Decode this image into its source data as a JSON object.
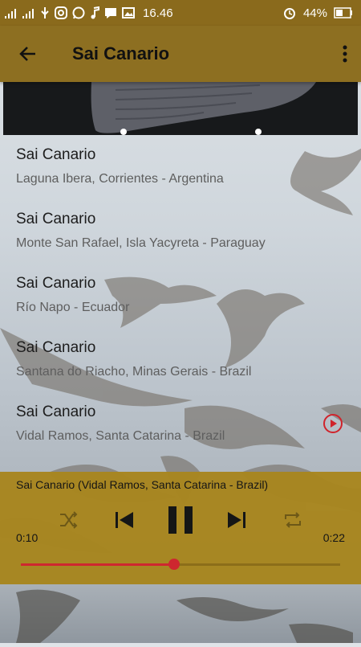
{
  "status_bar": {
    "time": "16.46",
    "battery": "44%",
    "left_icons": [
      "signal-icon",
      "signal-icon",
      "usb-icon",
      "instagram-icon",
      "whatsapp-icon",
      "music-note-icon",
      "message-icon",
      "image-icon"
    ],
    "right_icons": [
      "alarm-icon",
      "battery-icon"
    ]
  },
  "app_bar": {
    "title": "Sai Canario",
    "back_icon": "arrow-back-icon",
    "menu_icon": "more-vert-icon"
  },
  "tracks": [
    {
      "title": "Sai Canario",
      "subtitle": "Laguna Ibera, Corrientes - Argentina"
    },
    {
      "title": "Sai Canario",
      "subtitle": "Monte San Rafael, Isla Yacyreta - Paraguay"
    },
    {
      "title": "Sai Canario",
      "subtitle": "Río Napo - Ecuador"
    },
    {
      "title": "Sai Canario",
      "subtitle": "Santana do Riacho, Minas Gerais - Brazil"
    },
    {
      "title": "Sai Canario",
      "subtitle": "Vidal Ramos, Santa Catarina - Brazil",
      "playing": true
    }
  ],
  "player": {
    "now_playing": "Sai Canario (Vidal Ramos, Santa Catarina - Brazil)",
    "current_time": "0:10",
    "total_time": "0:22",
    "progress": 0.48,
    "colors": {
      "accent": "#d0232b",
      "bar": "#a8861f"
    }
  }
}
